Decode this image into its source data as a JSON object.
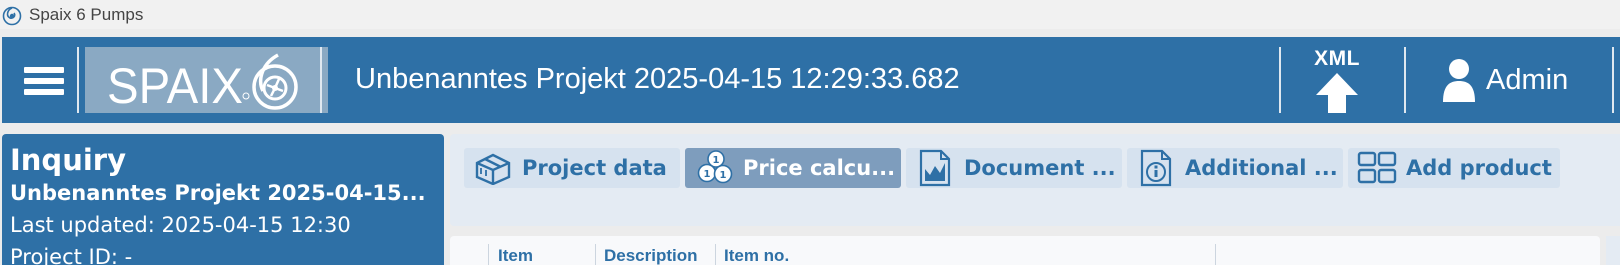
{
  "window": {
    "title": "Spaix 6 Pumps"
  },
  "header": {
    "logo_text": "SPAIX",
    "logo_version": "6",
    "project_title": "Unbenanntes Projekt 2025-04-15 12:29:33.682",
    "xml_label": "XML",
    "user_name": "Admin"
  },
  "inquiry": {
    "heading": "Inquiry",
    "project_name": "Unbenanntes Projekt 2025-04-15...",
    "last_updated": "Last updated: 2025-04-15 12:30",
    "project_id": "Project ID: -"
  },
  "tabs": [
    {
      "label": "Project data",
      "icon": "box-icon",
      "active": false
    },
    {
      "label": "Price calcu...",
      "icon": "coins-icon",
      "active": true
    },
    {
      "label": "Document ...",
      "icon": "chart-document-icon",
      "active": false
    },
    {
      "label": "Additional ...",
      "icon": "info-document-icon",
      "active": false
    },
    {
      "label": "Add product",
      "icon": "grid-icon",
      "active": false
    }
  ],
  "table": {
    "columns": [
      "Item",
      "Description",
      "Item no."
    ]
  },
  "colors": {
    "header_blue": "#2e70a6",
    "logo_bg": "#8aa9c3",
    "tab_bg": "#d6e2ef",
    "tab_active_bg": "#7e9dbd",
    "panel_bg": "#e4ebf3"
  }
}
